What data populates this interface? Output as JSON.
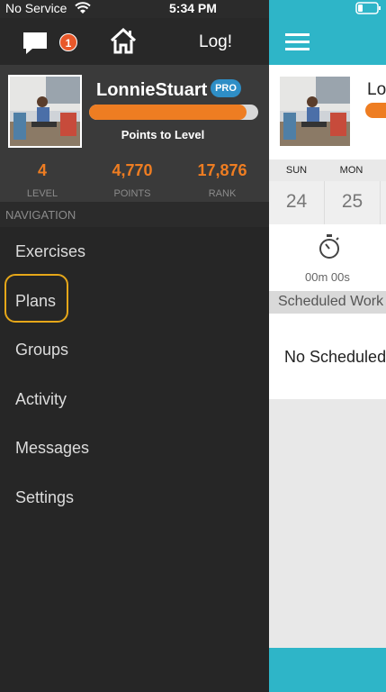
{
  "status_bar": {
    "carrier": "No Service",
    "time": "5:34 PM"
  },
  "header": {
    "chat_badge_count": "1",
    "log_label": "Log!"
  },
  "profile": {
    "username": "LonnieStuart",
    "badge": "PRO",
    "progress_fraction": 0.93,
    "points_to_level_label": "Points to Level",
    "stats": [
      {
        "value": "4",
        "label": "LEVEL"
      },
      {
        "value": "4,770",
        "label": "POINTS"
      },
      {
        "value": "17,876",
        "label": "RANK"
      }
    ]
  },
  "navigation": {
    "title": "NAVIGATION",
    "items": [
      {
        "label": "Exercises"
      },
      {
        "label": "Plans"
      },
      {
        "label": "Groups"
      },
      {
        "label": "Activity"
      },
      {
        "label": "Messages"
      },
      {
        "label": "Settings"
      }
    ],
    "highlighted": "Plans"
  },
  "main": {
    "profile_name": "Lo",
    "calendar": {
      "days": [
        "SUN",
        "MON"
      ],
      "dates": [
        "24",
        "25"
      ]
    },
    "timer": "00m 00s",
    "scheduled_title": "Scheduled Work",
    "no_scheduled": "No Scheduled"
  },
  "colors": {
    "accent_orange": "#ee7d22",
    "teal": "#2eb5c8",
    "pro_blue": "#2e8ec6",
    "highlight_yellow": "#e6a719",
    "drawer_bg": "#2b2b2b"
  }
}
